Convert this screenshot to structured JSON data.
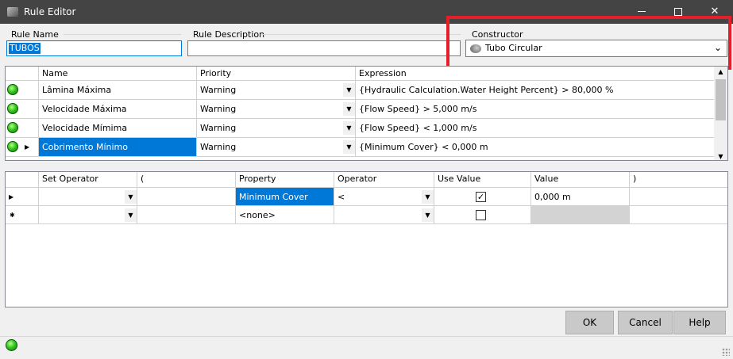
{
  "window": {
    "title": "Rule Editor",
    "min_glyph": "",
    "max_glyph": "",
    "close_glyph": "✕"
  },
  "form": {
    "rule_name_label": "Rule Name",
    "rule_name_value": "TUBOS",
    "rule_description_label": "Rule Description",
    "rule_description_value": "",
    "constructor_label": "Constructor",
    "constructor_value": "Tubo Circular"
  },
  "rules_grid": {
    "headers": [
      "Name",
      "Priority",
      "Expression"
    ],
    "rows": [
      {
        "name": "Lâmina Máxima",
        "priority": "Warning",
        "expression": "{Hydraulic Calculation.Water Height Percent} > 80,000 %"
      },
      {
        "name": "Velocidade Máxima",
        "priority": "Warning",
        "expression": "{Flow Speed} > 5,000 m/s"
      },
      {
        "name": "Velocidade Mímima",
        "priority": "Warning",
        "expression": "{Flow Speed} < 1,000 m/s"
      },
      {
        "name": "Cobrimento Mínimo",
        "priority": "Warning",
        "expression": "{Minimum Cover} < 0,000 m"
      }
    ]
  },
  "conditions_grid": {
    "headers": [
      "Set Operator",
      "(",
      "Property",
      "Operator",
      "Use Value",
      "Value",
      ")"
    ],
    "rows": [
      {
        "set_operator": "",
        "open_paren": "",
        "property": "Minimum Cover",
        "operator": "<",
        "use_value": true,
        "value": "0,000 m",
        "close_paren": ""
      },
      {
        "set_operator": "",
        "open_paren": "",
        "property": "<none>",
        "operator": "",
        "use_value": false,
        "value": "",
        "close_paren": ""
      }
    ]
  },
  "buttons": {
    "ok": "OK",
    "cancel": "Cancel",
    "help": "Help"
  },
  "glyphs": {
    "dropdown": "▼",
    "row_current": "▶",
    "row_new": "✱",
    "check": "✓",
    "combo_arrow": "⌄",
    "scroll_up": "▲",
    "scroll_down": "▼"
  },
  "colors": {
    "selection": "#0078d7",
    "highlight_box": "#e3202a",
    "status_led": "#37c81f"
  }
}
